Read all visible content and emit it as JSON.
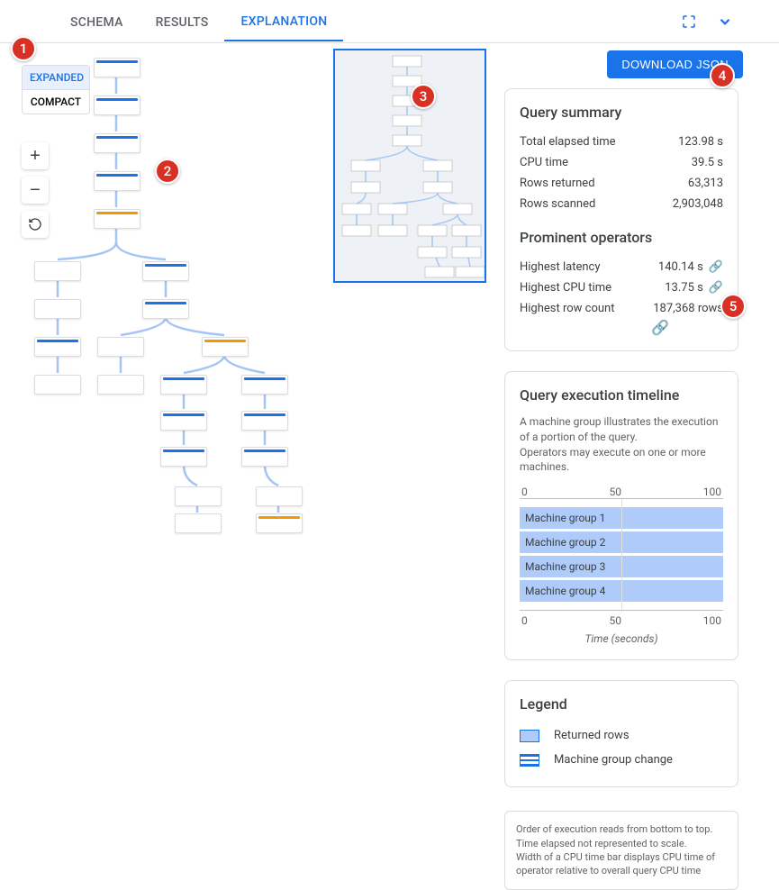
{
  "tabs": {
    "schema": "SCHEMA",
    "results": "RESULTS",
    "explanation": "EXPLANATION"
  },
  "download_btn": "DOWNLOAD JSON",
  "view_toggle": {
    "expanded": "EXPANDED",
    "compact": "COMPACT"
  },
  "query_summary": {
    "title": "Query summary",
    "metrics": [
      {
        "label": "Total elapsed time",
        "value": "123.98 s"
      },
      {
        "label": "CPU time",
        "value": "39.5 s"
      },
      {
        "label": "Rows returned",
        "value": "63,313"
      },
      {
        "label": "Rows scanned",
        "value": "2,903,048"
      }
    ],
    "prominent_title": "Prominent operators",
    "prominent": [
      {
        "label": "Highest latency",
        "value": "140.14 s",
        "link": true
      },
      {
        "label": "Highest CPU time",
        "value": "13.75 s",
        "link": true
      },
      {
        "label": "Highest row count",
        "value": "187,368 rows",
        "link": true
      }
    ]
  },
  "timeline": {
    "title": "Query execution timeline",
    "desc1": "A machine group illustrates the execution of a portion of the query.",
    "desc2": "Operators may execute on one or more machines.",
    "axis": {
      "min": "0",
      "mid": "50",
      "max": "100"
    },
    "groups": [
      "Machine group 1",
      "Machine group 2",
      "Machine group 3",
      "Machine group 4"
    ],
    "axis_label": "Time (seconds)"
  },
  "legend": {
    "title": "Legend",
    "returned_rows": "Returned rows",
    "mg_change": "Machine group change"
  },
  "disclaimer": {
    "l1": "Order of execution reads from bottom to top.",
    "l2": "Time elapsed not represented to scale.",
    "l3": "Width of a CPU time bar displays CPU time of operator relative to overall query CPU time"
  },
  "callouts": {
    "c1": "1",
    "c2": "2",
    "c3": "3",
    "c4": "4",
    "c5": "5"
  },
  "chart_data": {
    "type": "bar",
    "title": "Query execution timeline",
    "xlabel": "Time (seconds)",
    "ylabel": "",
    "xlim": [
      0,
      100
    ],
    "categories": [
      "Machine group 1",
      "Machine group 2",
      "Machine group 3",
      "Machine group 4"
    ],
    "values": [
      100,
      100,
      100,
      100
    ]
  }
}
